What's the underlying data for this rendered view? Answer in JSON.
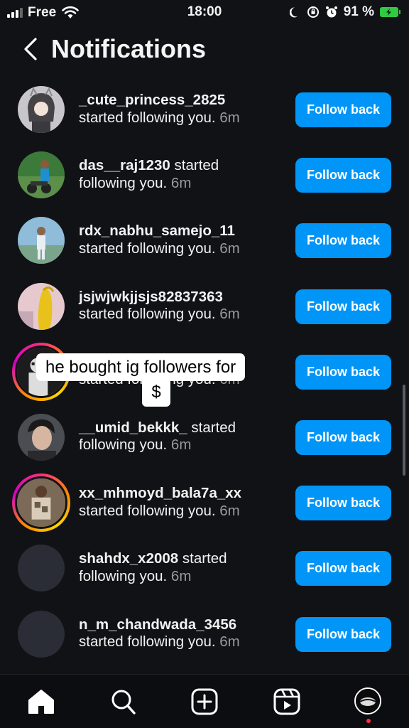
{
  "status_bar": {
    "carrier": "Free",
    "time": "18:00",
    "battery": "91 %"
  },
  "header": {
    "title": "Notifications"
  },
  "notifications": [
    {
      "username": "_cute_princess_2825",
      "text": "started following you.",
      "time": "6m",
      "button": "Follow back"
    },
    {
      "username": "das__raj1230",
      "text": "started following you.",
      "time": "6m",
      "button": "Follow back"
    },
    {
      "username": "rdx_nabhu_samejo_11",
      "text": "started following you.",
      "time": "6m",
      "button": "Follow back"
    },
    {
      "username": "jsjwjwkjjsjs82837363",
      "text": "started following you.",
      "time": "6m",
      "button": "Follow back"
    },
    {
      "username": "",
      "text": "started following you.",
      "time": "6m",
      "button": "Follow back"
    },
    {
      "username": "__umid_bekkk_",
      "text": "started following you.",
      "time": "6m",
      "button": "Follow back"
    },
    {
      "username": "xx_mhmoyd_bala7a_xx",
      "text": "started following you.",
      "time": "6m",
      "button": "Follow back"
    },
    {
      "username": "shahdx_x2008",
      "text": "started following you.",
      "time": "6m",
      "button": "Follow back"
    },
    {
      "username": "n_m_chandwada_3456",
      "text": "started following you.",
      "time": "6m",
      "button": "Follow back"
    }
  ],
  "caption": {
    "line1": "he bought ig followers for",
    "line2": "$"
  },
  "bottom_nav": [
    "home-icon",
    "search-icon",
    "create-icon",
    "reels-icon",
    "profile-avatar"
  ],
  "colors": {
    "background": "#101216",
    "button": "#0095f6",
    "story_ring": "#ff2f7d"
  }
}
